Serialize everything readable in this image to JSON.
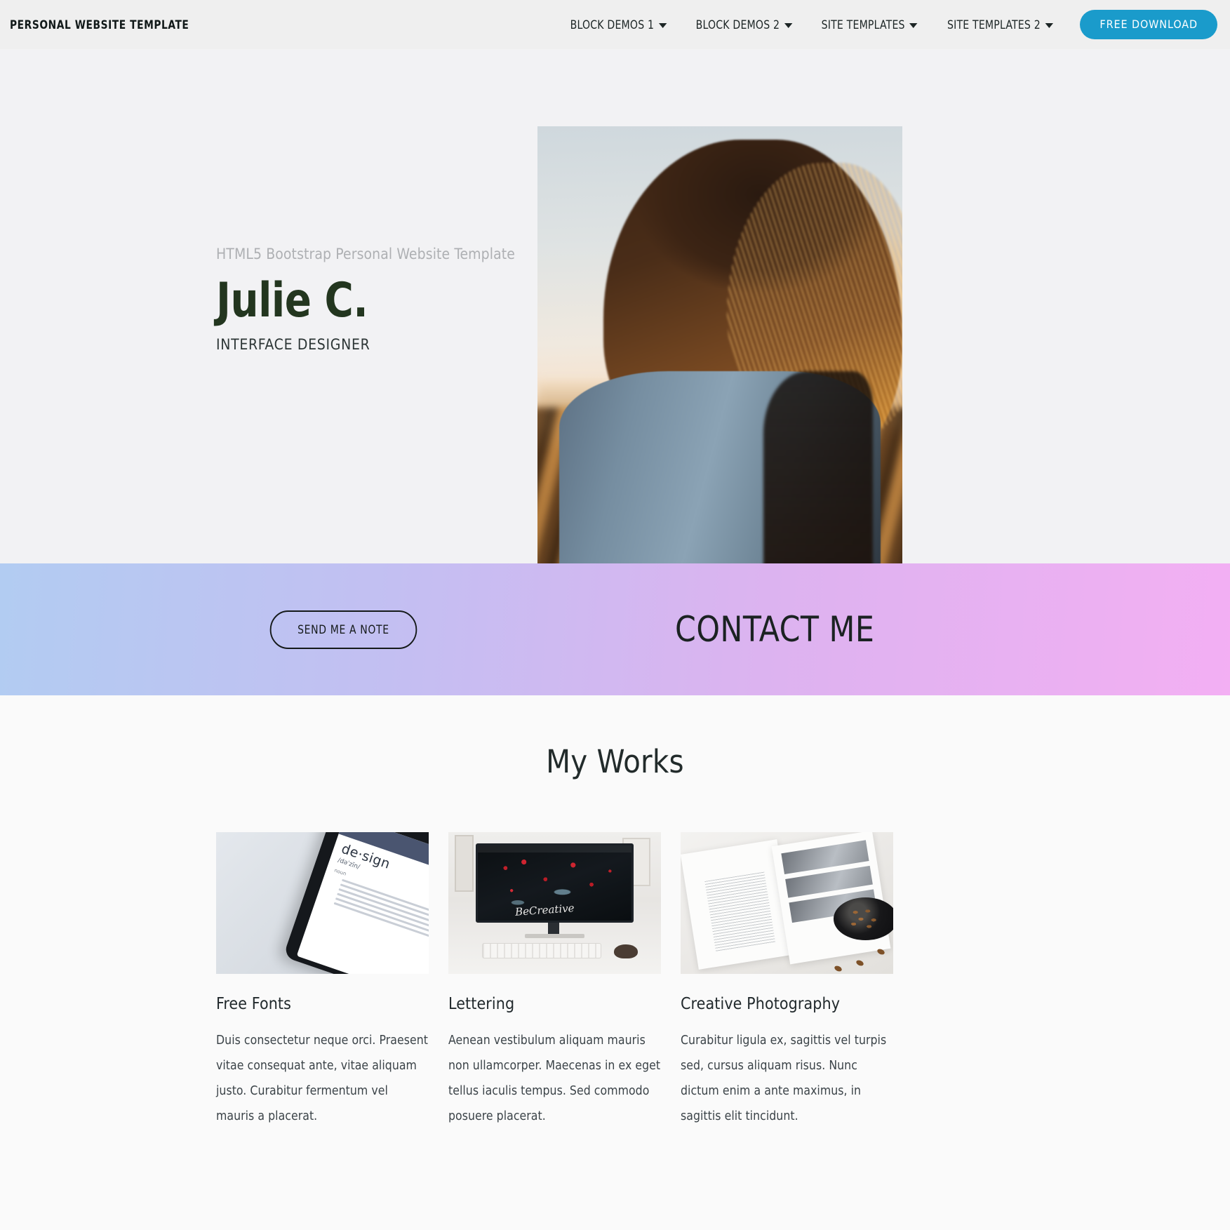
{
  "header": {
    "brand": "PERSONAL WEBSITE TEMPLATE",
    "nav_items": [
      {
        "label": "BLOCK DEMOS 1",
        "caret": "chevron-down-icon"
      },
      {
        "label": "BLOCK DEMOS 2",
        "caret": "chevron-down-icon"
      },
      {
        "label": "SITE TEMPLATES",
        "caret": "chevron-down-icon"
      },
      {
        "label": "SITE TEMPLATES 2",
        "caret": "chevron-down-icon"
      }
    ],
    "cta_label": "FREE DOWNLOAD",
    "cta_color": "#1a9bcb",
    "background": "#efefef"
  },
  "hero": {
    "kicker": "HTML5 Bootstrap Personal Website Template",
    "name": "Julie C.",
    "role": "INTERFACE DESIGNER",
    "name_color": "#23361f",
    "background": "#f2f2f4",
    "image_alt": "Woman with long hair backlit by sunset wearing a denim jacket"
  },
  "contact": {
    "button_label": "SEND ME A NOTE",
    "title": "CONTACT ME",
    "gradient_from": "#b2ccf2",
    "gradient_to": "#f3aff3"
  },
  "works": {
    "section_title": "My Works",
    "background": "#fafafa",
    "cards": [
      {
        "title": "Free Fonts",
        "description": "Duis consectetur neque orci. Praesent vitae consequat ante, vitae aliquam justo. Curabitur fermentum vel mauris a placerat.",
        "image_alt": "Smartphone showing the dictionary definition of design",
        "image_text": {
          "word": "de·sign",
          "pronunciation": "/dəˈzīn/",
          "part_of_speech": "noun"
        }
      },
      {
        "title": "Lettering",
        "description": "Aenean vestibulum aliquam mauris non ullamcorper. Maecenas in ex eget tellus iaculis tempus. Sed commodo posuere placerat.",
        "image_alt": "Desktop monitor on a white desk with dark berry wallpaper",
        "image_text": {
          "wallpaper_script": "BeCreative"
        }
      },
      {
        "title": "Creative Photography",
        "description": "Curabitur ligula ex, sagittis vel turpis sed, cursus aliquam risus. Nunc dictum enim a ante maximus, in sagittis elit tincidunt.",
        "image_alt": "Open magazine with black and white photos beside a bowl of nuts"
      }
    ]
  }
}
